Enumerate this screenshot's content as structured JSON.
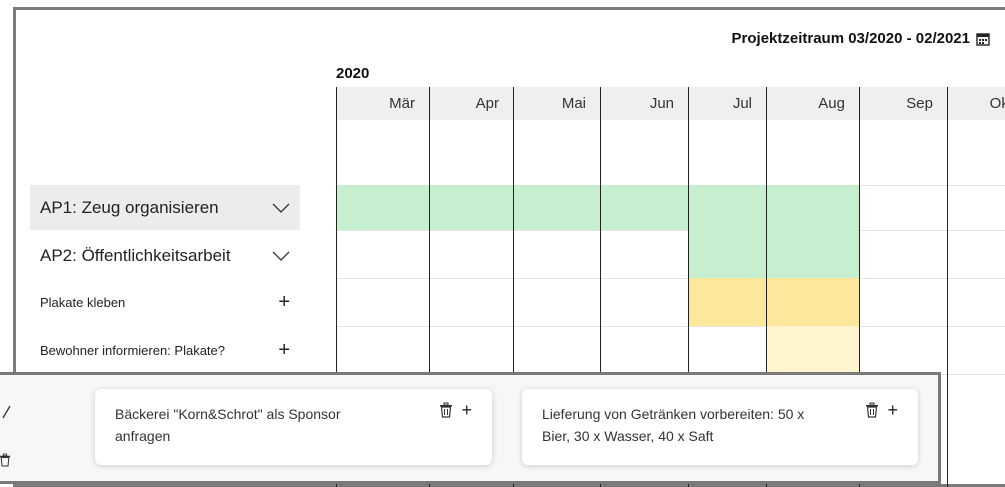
{
  "header": {
    "project_period": "Projektzeitraum 03/2020 - 02/2021"
  },
  "timeline": {
    "year": "2020",
    "months": [
      "Mär",
      "Apr",
      "Mai",
      "Jun",
      "Jul",
      "Aug",
      "Sep",
      "Okt"
    ]
  },
  "rows": [
    {
      "label": "AP1: Zeug organisieren"
    },
    {
      "label": "AP2: Öffentlichkeitsarbeit"
    },
    {
      "label": "Plakate kleben"
    },
    {
      "label": "Bewohner informieren: Plakate?"
    }
  ],
  "cards": [
    {
      "text": "Bäckerei \"Korn&Schrot\" als Sponsor anfragen"
    },
    {
      "text": "Lieferung von Getränken vorbereiten: 50 x Bier, 30 x Wasser, 40 x Saft"
    }
  ],
  "colors": {
    "green": "#c6efcf",
    "yellow": "#fde79a",
    "light_yellow": "#fff6cf",
    "header_bg": "#efefef"
  }
}
